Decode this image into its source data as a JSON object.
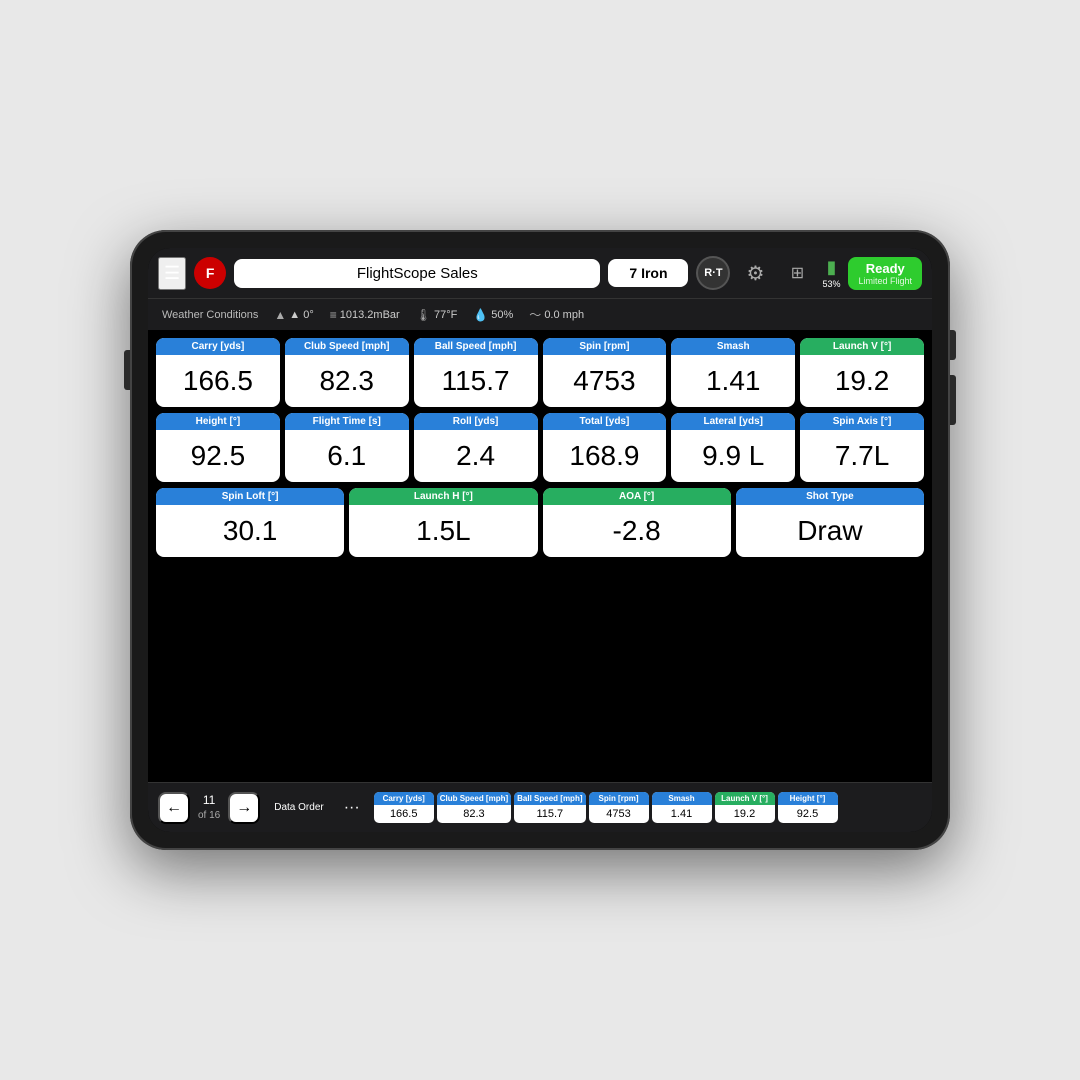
{
  "header": {
    "menu_label": "☰",
    "logo_text": "F",
    "title": "FlightScope Sales",
    "club": "7 Iron",
    "rt_label": "R·T",
    "battery_pct": "53%",
    "ready_label": "Ready",
    "ready_sub": "Limited Flight"
  },
  "weather": {
    "label": "Weather Conditions",
    "wind": "▲ 0°",
    "pressure": "1013.2mBar",
    "temp": "77°F",
    "humidity": "50%",
    "wind_speed": "0.0 mph"
  },
  "metrics_row1": [
    {
      "header": "Carry [yds]",
      "value": "166.5",
      "color": "blue"
    },
    {
      "header": "Club Speed [mph]",
      "value": "82.3",
      "color": "blue"
    },
    {
      "header": "Ball Speed [mph]",
      "value": "115.7",
      "color": "blue"
    },
    {
      "header": "Spin [rpm]",
      "value": "4753",
      "color": "blue"
    },
    {
      "header": "Smash",
      "value": "1.41",
      "color": "blue"
    },
    {
      "header": "Launch V [°]",
      "value": "19.2",
      "color": "green"
    }
  ],
  "metrics_row2": [
    {
      "header": "Height [°]",
      "value": "92.5",
      "color": "blue"
    },
    {
      "header": "Flight Time [s]",
      "value": "6.1",
      "color": "blue"
    },
    {
      "header": "Roll [yds]",
      "value": "2.4",
      "color": "blue"
    },
    {
      "header": "Total [yds]",
      "value": "168.9",
      "color": "blue"
    },
    {
      "header": "Lateral [yds]",
      "value": "9.9 L",
      "color": "blue"
    },
    {
      "header": "Spin Axis [°]",
      "value": "7.7L",
      "color": "blue"
    }
  ],
  "metrics_row3": [
    {
      "header": "Spin Loft [°]",
      "value": "30.1",
      "color": "blue"
    },
    {
      "header": "Launch H [°]",
      "value": "1.5L",
      "color": "green"
    },
    {
      "header": "AOA [°]",
      "value": "-2.8",
      "color": "green"
    },
    {
      "header": "Shot Type",
      "value": "Draw",
      "color": "blue"
    }
  ],
  "bottom_nav": {
    "prev_label": "←",
    "next_label": "→",
    "count": "11",
    "count_sub": "of 16",
    "data_label": "Data\nOrder",
    "more_label": "···"
  },
  "bottom_data": [
    {
      "header": "Carry [yds]",
      "value": "166.5",
      "color": "blue"
    },
    {
      "header": "Club Speed [mph]",
      "value": "82.3",
      "color": "blue"
    },
    {
      "header": "Ball Speed [mph]",
      "value": "115.7",
      "color": "blue"
    },
    {
      "header": "Spin [rpm]",
      "value": "4753",
      "color": "blue"
    },
    {
      "header": "Smash",
      "value": "1.41",
      "color": "blue"
    },
    {
      "header": "Launch V [°]",
      "value": "19.2",
      "color": "green"
    },
    {
      "header": "Height [°]",
      "value": "92.5",
      "color": "blue"
    }
  ]
}
